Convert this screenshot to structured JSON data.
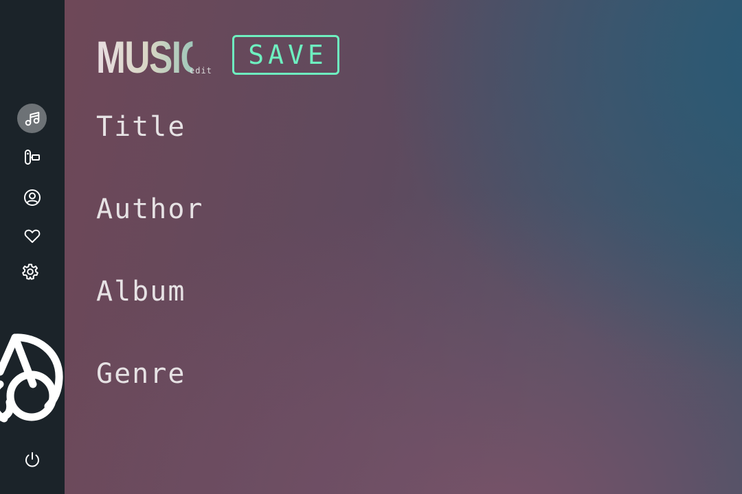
{
  "app": {
    "brand_title": "MUSIC",
    "brand_subtitle": "edit"
  },
  "toolbar": {
    "save_label": "SAVE"
  },
  "sidebar": {
    "items": [
      {
        "icon": "music-note-icon",
        "active": true
      },
      {
        "icon": "media-player-icon",
        "active": false
      },
      {
        "icon": "user-circle-icon",
        "active": false
      },
      {
        "icon": "heart-icon",
        "active": false
      },
      {
        "icon": "gear-icon",
        "active": false
      }
    ],
    "logo_icon": "cherry-logo-icon",
    "power_icon": "power-icon"
  },
  "fields": [
    {
      "label": "Title"
    },
    {
      "label": "Author"
    },
    {
      "label": "Album"
    },
    {
      "label": "Genre"
    }
  ],
  "colors": {
    "accent": "#6ef0c0",
    "sidebar_bg": "#1b2329",
    "active_item_bg": "#6d7276"
  }
}
